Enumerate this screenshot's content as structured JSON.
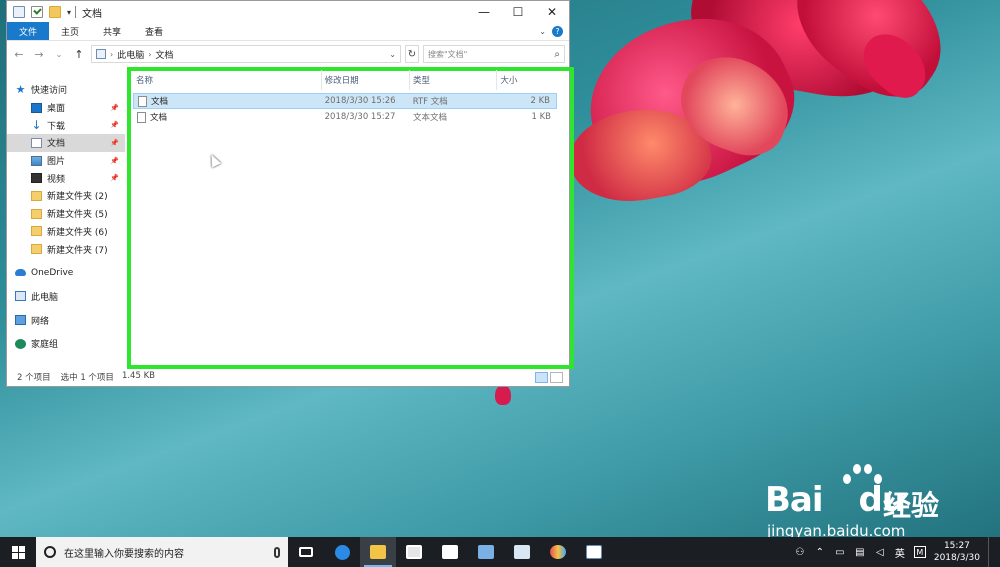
{
  "window": {
    "title": "文档",
    "controls": [
      "—",
      "☐",
      "✕"
    ]
  },
  "ribbon": {
    "tabs": [
      "文件",
      "主页",
      "共享",
      "查看"
    ],
    "help": "?"
  },
  "address": {
    "path": [
      "此电脑",
      "文档"
    ],
    "search_placeholder": "搜索\"文档\""
  },
  "nav": {
    "quick_access": "快速访问",
    "items": [
      {
        "label": "桌面",
        "icon": "desktop-icon",
        "pinned": true
      },
      {
        "label": "下载",
        "icon": "download-icon",
        "pinned": true
      },
      {
        "label": "文档",
        "icon": "documents-icon",
        "pinned": true,
        "selected": true
      },
      {
        "label": "图片",
        "icon": "pictures-icon",
        "pinned": true
      },
      {
        "label": "视频",
        "icon": "videos-icon",
        "pinned": true
      },
      {
        "label": "新建文件夹 (2)",
        "icon": "folder-icon"
      },
      {
        "label": "新建文件夹 (5)",
        "icon": "folder-icon"
      },
      {
        "label": "新建文件夹 (6)",
        "icon": "folder-icon"
      },
      {
        "label": "新建文件夹 (7)",
        "icon": "folder-icon"
      }
    ],
    "onedrive": "OneDrive",
    "this_pc": "此电脑",
    "network": "网络",
    "homegroup": "家庭组"
  },
  "columns": {
    "name": "名称",
    "date": "修改日期",
    "type": "类型",
    "size": "大小"
  },
  "files": [
    {
      "name": "文档",
      "date": "2018/3/30 15:26",
      "type": "RTF 文档",
      "size": "2 KB",
      "selected": true
    },
    {
      "name": "文档",
      "date": "2018/3/30 15:27",
      "type": "文本文档",
      "size": "1 KB",
      "selected": false
    }
  ],
  "status": {
    "count": "2 个项目",
    "selection": "选中 1 个项目",
    "selection_size": "1.45 KB"
  },
  "watermark": {
    "brand": "Bai",
    "brand_du": "du",
    "cn": "经验",
    "url": "jingyan.baidu.com"
  },
  "taskbar": {
    "search_placeholder": "在这里输入你要搜索的内容",
    "ime": "英",
    "ime_mode": "M",
    "time": "15:27",
    "date": "2018/3/30"
  },
  "colors": {
    "highlight_frame": "#2ee62e",
    "ribbon_file_tab": "#1979ca",
    "selection": "#cde6f7",
    "taskbar": "#1b1f24"
  }
}
